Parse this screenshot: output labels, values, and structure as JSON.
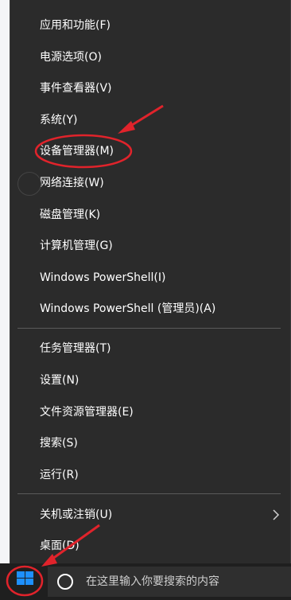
{
  "context_menu": {
    "items": [
      {
        "label": "应用和功能(F)"
      },
      {
        "label": "电源选项(O)"
      },
      {
        "label": "事件查看器(V)"
      },
      {
        "label": "系统(Y)"
      },
      {
        "label": "设备管理器(M)"
      },
      {
        "label": "网络连接(W)"
      },
      {
        "label": "磁盘管理(K)"
      },
      {
        "label": "计算机管理(G)"
      },
      {
        "label": "Windows PowerShell(I)"
      },
      {
        "label": "Windows PowerShell (管理员)(A)"
      },
      {
        "label": "任务管理器(T)"
      },
      {
        "label": "设置(N)"
      },
      {
        "label": "文件资源管理器(E)"
      },
      {
        "label": "搜索(S)"
      },
      {
        "label": "运行(R)"
      },
      {
        "label": "关机或注销(U)"
      },
      {
        "label": "桌面(D)"
      }
    ],
    "submenu_icon": "chevron-right-icon"
  },
  "taskbar": {
    "start_icon": "windows-logo-icon",
    "search_icon": "cortana-circle-icon",
    "search_placeholder": "在这里输入你要搜索的内容"
  },
  "colors": {
    "menu_bg": "#2b2b2b",
    "menu_text": "#ffffff",
    "separator": "#5a5a5a",
    "annotation_red": "#e0232b",
    "start_blue": "#1e90ff"
  }
}
